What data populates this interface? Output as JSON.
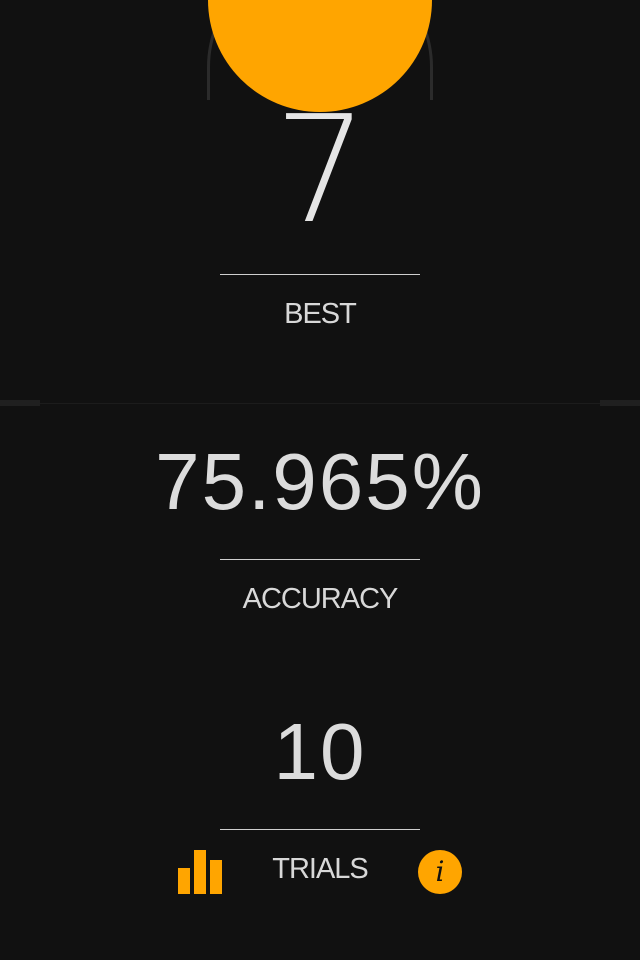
{
  "colors": {
    "accent": "#FFA500",
    "background": "#111111",
    "text": "#e6e6e6"
  },
  "best": {
    "value": "7",
    "label": "BEST"
  },
  "accuracy": {
    "value": "75.965%",
    "label": "ACCURACY"
  },
  "trials": {
    "value": "10",
    "label": "TRIALS"
  },
  "toolbar": {
    "stats_icon": "bar-chart-icon",
    "info_icon": "info-icon",
    "info_glyph": "i"
  }
}
